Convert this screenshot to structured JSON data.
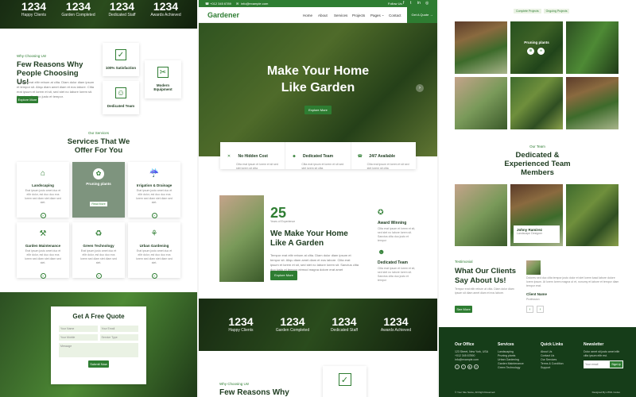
{
  "left": {
    "stats": [
      {
        "number": "1234",
        "label": "Happy Clients"
      },
      {
        "number": "1234",
        "label": "Garden Completed"
      },
      {
        "number": "1234",
        "label": "Dedicated Staff"
      },
      {
        "number": "1234",
        "label": "Awards Achieved"
      }
    ],
    "why": {
      "eyebrow": "Why Choosing Us!",
      "title": "Few Reasons Why People Choosing Us!",
      "text": "Tempor erat elitr rebum at clita. Diam dolor diam ipsum et tempor sit. Aliqu diam amet diam et eos labore. Clita erat ipsum et lorem et sit, sed stet no labore lorem sit. Sanctus clita duo justo et tempor.",
      "button": "Explore More",
      "features": [
        "100% Satisfaction",
        "Dedicated Team",
        "Modern Equipment"
      ]
    },
    "services": {
      "eyebrow": "Our Services",
      "title": "Services That We Offer For You",
      "items": [
        {
          "name": "Landscaping",
          "text": "Erat ipsum justo amet duo et elitr dolor, est duo duo eos lorem sed diam stet diam sed stet."
        },
        {
          "name": "Pruning plants",
          "text": "",
          "button": "Read More"
        },
        {
          "name": "Irrigation & Drainage",
          "text": "Erat ipsum justo amet duo et elitr dolor, est duo duo eos lorem sed diam stet diam sed stet."
        },
        {
          "name": "Garden Maintenance",
          "text": "Erat ipsum justo amet duo et elitr dolor, est duo duo eos lorem sed diam stet diam sed stet."
        },
        {
          "name": "Green Technology",
          "text": "Erat ipsum justo amet duo et elitr dolor, est duo duo eos lorem sed diam stet diam sed stet."
        },
        {
          "name": "Urban Gardening",
          "text": "Erat ipsum justo amet duo et elitr dolor, est duo duo eos lorem sed diam stet diam sed stet."
        }
      ]
    },
    "quote": {
      "title": "Get A Free Quote",
      "your_name": "Your Name",
      "your_email": "Your Email",
      "your_mobile": "Your Mobile",
      "service_type": "Service Type",
      "message": "Message",
      "submit": "Submit Now"
    }
  },
  "mid": {
    "topbar": {
      "phone": "+012 345 6789",
      "email": "info@example.com",
      "follow": "Follow Us:"
    },
    "brand": "Gardener",
    "nav": [
      "Home",
      "About",
      "Services",
      "Projects",
      "Pages",
      "Contact"
    ],
    "quote_button": "Get A Quote",
    "hero": {
      "title": "Make Your Home Like Garden",
      "button": "Explore More"
    },
    "features": [
      {
        "title": "No Hidden Cost",
        "text": "Clita erat ipsum et lorem et sit sed stet lorem sit clita"
      },
      {
        "title": "Dedicated Team",
        "text": "Clita erat ipsum et lorem et sit sed stet lorem sit clita"
      },
      {
        "title": "24/7 Available",
        "text": "Clita erat ipsum et lorem et sit sed stet lorem sit clita"
      }
    ],
    "about": {
      "years": "25",
      "years_label": "Years of Experience",
      "title": "We Make Your Home Like A Garden",
      "text": "Tempor erat elitr rebum at clita. Diam dolor diam ipsum et tempor sit. Aliqu diam amet diam et eos labore. Clita erat ipsum et lorem et sit, sed stet no labore lorem sit. Sanctus clita duo justo et tempor eirmod magna dolore erat amet",
      "button": "Explore More",
      "award": {
        "title": "Award Winning",
        "text": "Clita erat ipsum et lorem et sit, sed stet no labore lorem sit. Sanctus clita duo justo et tempor"
      },
      "team": {
        "title": "Dedicated Team",
        "text": "Clita erat ipsum et lorem et sit, sed stet no labore lorem sit. Sanctus clita duo justo et tempor"
      }
    },
    "stats": [
      {
        "number": "1234",
        "label": "Happy Clients"
      },
      {
        "number": "1234",
        "label": "Garden Completed"
      },
      {
        "number": "1234",
        "label": "Dedicated Staff"
      },
      {
        "number": "1234",
        "label": "Awards Achieved"
      }
    ],
    "why_eyebrow": "Why Choosing Us!",
    "why_title": "Few Reasons Why"
  },
  "right": {
    "filters": [
      "Complete Projects",
      "Ongoing Projects"
    ],
    "gallery_label": "Pruning plants",
    "team": {
      "eyebrow": "Our Team",
      "title": "Dedicated & Experienced Team Members",
      "member": {
        "name": "Johny Ramirez",
        "role": "Landscape Designer"
      }
    },
    "testimonial": {
      "eyebrow": "Testimonial",
      "title": "What Our Clients Say About Us!",
      "text": "Tempor erat elitr rebum at clita. Diam dolor diam ipsum sit diam amet diam et eos labore.",
      "button": "See More",
      "quote": "Dolores sed duo clita tempor justo dolor et stet lorem kasd labore dolore lorem ipsum. At lorem lorem magna ut et, nonumy et labore et tempor diam tempor erat.",
      "client": "Client Name",
      "profession": "Profession"
    },
    "footer": {
      "office": {
        "title": "Our Office",
        "address": "123 Street, New York, USA",
        "phone": "+012 345 67890",
        "email": "info@example.com"
      },
      "services": {
        "title": "Services",
        "items": [
          "Landscaping",
          "Pruning plants",
          "Urban Gardening",
          "Garden Maintenance",
          "Green Technology"
        ]
      },
      "links": {
        "title": "Quick Links",
        "items": [
          "About Us",
          "Contact Us",
          "Our Services",
          "Terms & Condition",
          "Support"
        ]
      },
      "newsletter": {
        "title": "Newsletter",
        "text": "Dolor amet sit justo amet elitr clita ipsum elitr est.",
        "placeholder": "Your email",
        "button": "SignUp"
      },
      "copyright": "© Your Site Name, All Right Reserved.",
      "designed": "Designed By HTML Codex"
    }
  }
}
